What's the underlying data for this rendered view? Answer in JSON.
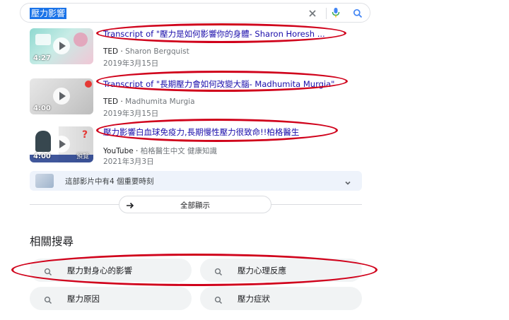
{
  "search": {
    "query": "壓力影響",
    "icons": [
      "close-icon",
      "mic-icon",
      "search-icon"
    ]
  },
  "videos": [
    {
      "title": "Transcript of \"壓力是如何影響你的身體- Sharon Horesh ...",
      "source": "TED",
      "channel": "Sharon Bergquist",
      "date": "2019年3月15日",
      "duration": "4:27"
    },
    {
      "title": "Transcript of \"長期壓力會如何改變大腦- Madhumita Murgia\"",
      "source": "TED",
      "channel": "Madhumita Murgia",
      "date": "2019年3月15日",
      "duration": "4:00"
    },
    {
      "title": "壓力影響白血球免疫力,長期慢性壓力很致命!!柏格醫生",
      "source": "YouTube",
      "channel": "柏格醫生中文 健康知識",
      "date": "2021年3月3日",
      "duration": "4:00",
      "preview": "預覽"
    }
  ],
  "key_moments": {
    "text": "這部影片中有4 個重要時刻"
  },
  "show_all": {
    "label": "全部顯示"
  },
  "related": {
    "heading": "相關搜尋",
    "items": [
      "壓力對身心的影響",
      "壓力心理反應",
      "壓力原因",
      "壓力症狀"
    ]
  },
  "colors": {
    "link": "#1a0dab",
    "highlight": "#1a73e8",
    "annotation": "#d0021b",
    "chip_bg": "#f1f3f4"
  }
}
